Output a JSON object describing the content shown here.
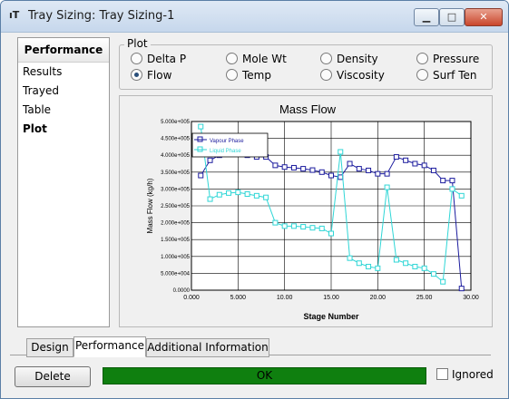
{
  "window": {
    "title": "Tray Sizing: Tray Sizing-1",
    "app_icon": "ıT",
    "close_label": "✕",
    "min_label": "▁",
    "max_label": "□"
  },
  "sidebar": {
    "header": "Performance",
    "items": [
      {
        "label": "Results"
      },
      {
        "label": "Trayed"
      },
      {
        "label": "Table"
      },
      {
        "label": "Plot",
        "active": true
      }
    ]
  },
  "plot_options": {
    "legend": "Plot",
    "options": [
      {
        "label": "Delta P",
        "selected": false
      },
      {
        "label": "Mole Wt",
        "selected": false
      },
      {
        "label": "Density",
        "selected": false
      },
      {
        "label": "Pressure",
        "selected": false
      },
      {
        "label": "Flow",
        "selected": true
      },
      {
        "label": "Temp",
        "selected": false
      },
      {
        "label": "Viscosity",
        "selected": false
      },
      {
        "label": "Surf Ten",
        "selected": false
      }
    ]
  },
  "chart_data": {
    "type": "line",
    "title": "Mass Flow",
    "xlabel": "Stage Number",
    "ylabel": "Mass Flow (kg/h)",
    "xlim": [
      0,
      30
    ],
    "ylim": [
      0,
      500000
    ],
    "xticks": [
      "0.000",
      "5.000",
      "10.00",
      "15.00",
      "20.00",
      "25.00",
      "30.00"
    ],
    "yticks": [
      "0.0000",
      "5.000e+004",
      "1.000e+005",
      "1.500e+005",
      "2.000e+005",
      "2.500e+005",
      "3.000e+005",
      "3.500e+005",
      "4.000e+005",
      "4.500e+005",
      "5.000e+005"
    ],
    "grid": true,
    "legend_position": "top-left",
    "series": [
      {
        "name": "Vapour Phase",
        "color": "#1c1c9e",
        "x": [
          1,
          2,
          3,
          4,
          5,
          6,
          7,
          8,
          9,
          10,
          11,
          12,
          13,
          14,
          15,
          16,
          17,
          18,
          19,
          20,
          21,
          22,
          23,
          24,
          25,
          26,
          27,
          28,
          29
        ],
        "y": [
          340000,
          385000,
          400000,
          405000,
          405000,
          400000,
          395000,
          395000,
          370000,
          365000,
          363000,
          360000,
          356000,
          350000,
          340000,
          335000,
          375000,
          360000,
          355000,
          345000,
          345000,
          395000,
          385000,
          375000,
          370000,
          355000,
          325000,
          325000,
          5000
        ]
      },
      {
        "name": "Liquid Phase",
        "color": "#2fd6d6",
        "x": [
          1,
          2,
          3,
          4,
          5,
          6,
          7,
          8,
          9,
          10,
          11,
          12,
          13,
          14,
          15,
          16,
          17,
          18,
          19,
          20,
          21,
          22,
          23,
          24,
          25,
          26,
          27,
          28,
          29
        ],
        "y": [
          485000,
          270000,
          283000,
          288000,
          290000,
          285000,
          280000,
          275000,
          200000,
          190000,
          190000,
          188000,
          185000,
          183000,
          168000,
          410000,
          95000,
          80000,
          70000,
          65000,
          305000,
          90000,
          80000,
          70000,
          65000,
          48000,
          25000,
          300000,
          280000
        ]
      }
    ]
  },
  "tabs": [
    {
      "label": "Design",
      "selected": false
    },
    {
      "label": "Performance",
      "selected": true
    },
    {
      "label": "Additional Information",
      "selected": false
    }
  ],
  "footer": {
    "delete_label": "Delete",
    "status": "OK",
    "status_color": "#0f7f0f",
    "ignored_label": "Ignored",
    "ignored_checked": false
  }
}
